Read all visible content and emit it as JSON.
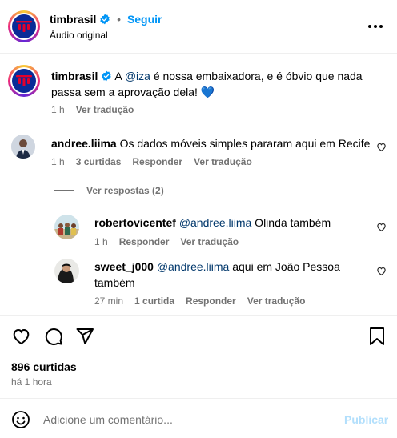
{
  "header": {
    "username": "timbrasil",
    "separator": "•",
    "follow_label": "Seguir",
    "subtitle": "Áudio original",
    "more_icon": "more-horizontal-icon"
  },
  "caption": {
    "username": "timbrasil",
    "text_before": "A ",
    "mention": "@iza",
    "text_after": " é nossa embaixadora, e é óbvio que nada passa sem a aprovação dela! ",
    "emoji": "💙",
    "time": "1 h",
    "translate": "Ver tradução"
  },
  "comments": [
    {
      "username": "andree.liima",
      "text": "Os dados móveis simples pararam aqui em Recife",
      "time": "1 h",
      "likes": "3 curtidas",
      "reply": "Responder",
      "translate": "Ver tradução",
      "view_replies": "Ver respostas (2)"
    }
  ],
  "replies": [
    {
      "username": "robertovicentef",
      "mention": "@andree.liima",
      "text": " Olinda também",
      "time": "1 h",
      "reply": "Responder",
      "translate": "Ver tradução"
    },
    {
      "username": "sweet_j000",
      "mention": "@andree.liima",
      "text_line1": " aqui em João Pessoa",
      "text_line2": "também",
      "time": "27 min",
      "likes": "1 curtida",
      "reply": "Responder",
      "translate": "Ver tradução"
    }
  ],
  "actions": {
    "icons": [
      "heart-icon",
      "comment-icon",
      "share-icon",
      "bookmark-icon"
    ],
    "likes": "896 curtidas",
    "posted": "há 1 hora"
  },
  "composer": {
    "placeholder": "Adicione um comentário...",
    "publish_label": "Publicar",
    "emoji_icon": "emoji-icon"
  },
  "colors": {
    "accent": "#0095f6",
    "link": "#00376b",
    "muted": "#737373",
    "verified": "#0095f6",
    "brand": "#0a2b97"
  }
}
